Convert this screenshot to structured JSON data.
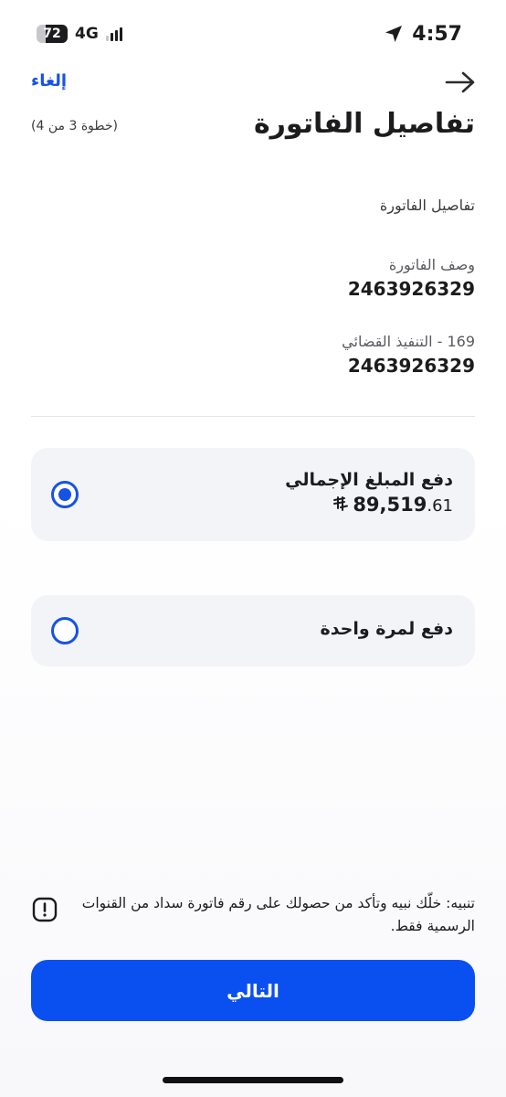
{
  "status_bar": {
    "battery": "72",
    "battery_level_percent": 72,
    "network": "4G",
    "signal_bars_active": 3,
    "signal_bars_total": 4,
    "time": "4:57",
    "location_icon": "location-arrow-icon"
  },
  "header": {
    "cancel_label": "إلغاء",
    "back_icon": "arrow-right-icon",
    "title": "تفاصيل الفاتورة",
    "step": "(خطوة 3 من 4)"
  },
  "details": {
    "section_label": "تفاصيل الفاتورة",
    "fields": [
      {
        "label": "وصف الفاتورة",
        "value": "2463926329"
      },
      {
        "label": "169 - التنفيذ القضائي",
        "value": "2463926329"
      }
    ]
  },
  "options": [
    {
      "title": "دفع المبلغ الإجمالي",
      "amount_integer": "89,519",
      "amount_decimal": ".61",
      "currency_symbol": "SAR-symbol",
      "selected": true
    },
    {
      "title": "دفع لمرة واحدة",
      "selected": false
    }
  ],
  "warning": {
    "icon": "exclamation-square-icon",
    "text": "تنبيه: خلّك نبيه وتأكد من حصولك على رقم فاتورة سداد من القنوات الرسمية فقط."
  },
  "next_button": {
    "label": "التالي"
  },
  "colors": {
    "accent": "#1552e6",
    "button": "#0a4ff0",
    "card": "#f3f4f8",
    "text": "#1c1c1e"
  }
}
